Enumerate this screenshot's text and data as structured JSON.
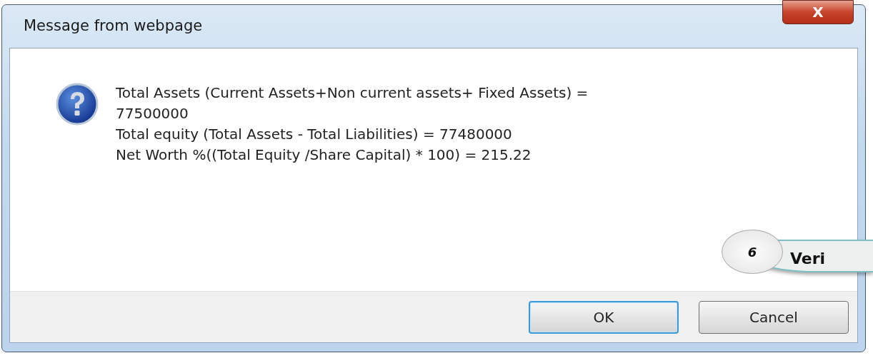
{
  "window": {
    "title": "Message from webpage",
    "close": "X"
  },
  "message": {
    "lines": [
      "Total Assets (Current Assets+Non current assets+ Fixed Assets) =",
      "77500000",
      "Total equity (Total Assets - Total Liabilities) = 77480000",
      "Net Worth %((Total Equity /Share Capital) * 100) = 215.22"
    ]
  },
  "buttons": [
    {
      "label": "OK",
      "selected": true
    },
    {
      "label": "Cancel",
      "selected": false
    }
  ],
  "callout": {
    "number": "6",
    "text": "Veri"
  }
}
